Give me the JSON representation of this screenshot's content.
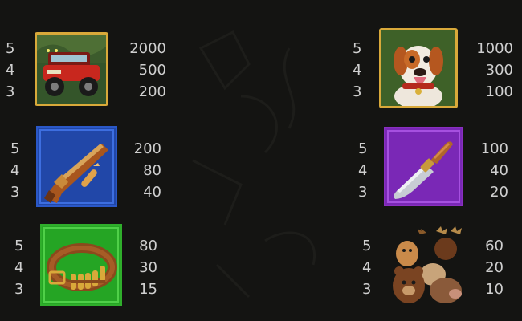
{
  "paytable": {
    "symbols": [
      {
        "id": "jeep",
        "icon": "jeep-icon",
        "frame_color": "#d9a93a",
        "rows": [
          {
            "count": "5",
            "payout": "2000"
          },
          {
            "count": "4",
            "payout": "500"
          },
          {
            "count": "3",
            "payout": "200"
          }
        ]
      },
      {
        "id": "dog",
        "icon": "dog-icon",
        "frame_color": "#d9a93a",
        "rows": [
          {
            "count": "5",
            "payout": "1000"
          },
          {
            "count": "4",
            "payout": "300"
          },
          {
            "count": "3",
            "payout": "100"
          }
        ]
      },
      {
        "id": "rifle",
        "icon": "rifle-icon",
        "frame_color": "#2a58c8",
        "rows": [
          {
            "count": "5",
            "payout": "200"
          },
          {
            "count": "4",
            "payout": "80"
          },
          {
            "count": "3",
            "payout": "40"
          }
        ]
      },
      {
        "id": "knife",
        "icon": "knife-icon",
        "frame_color": "#8a2fc0",
        "rows": [
          {
            "count": "5",
            "payout": "100"
          },
          {
            "count": "4",
            "payout": "40"
          },
          {
            "count": "3",
            "payout": "20"
          }
        ]
      },
      {
        "id": "ammo-belt",
        "icon": "ammo-belt-icon",
        "frame_color": "#2fae2b",
        "rows": [
          {
            "count": "5",
            "payout": "80"
          },
          {
            "count": "4",
            "payout": "30"
          },
          {
            "count": "3",
            "payout": "15"
          }
        ]
      },
      {
        "id": "animals",
        "icon": "animals-icon",
        "frame_color": "none",
        "rows": [
          {
            "count": "5",
            "payout": "60"
          },
          {
            "count": "4",
            "payout": "20"
          },
          {
            "count": "3",
            "payout": "10"
          }
        ]
      }
    ]
  }
}
